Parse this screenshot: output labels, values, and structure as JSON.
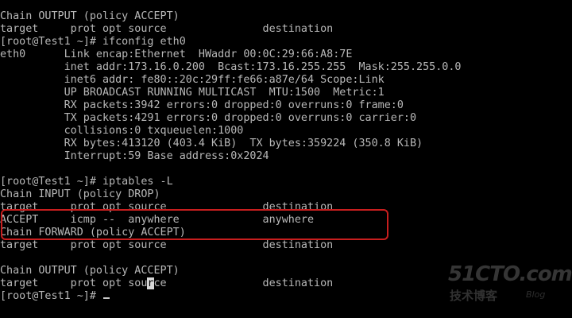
{
  "terminal": {
    "lines": [
      "Chain OUTPUT (policy ACCEPT)",
      "target     prot opt source               destination",
      "[root@Test1 ~]# ifconfig eth0",
      "eth0      Link encap:Ethernet  HWaddr 00:0C:29:66:A8:7E",
      "          inet addr:173.16.0.200  Bcast:173.16.255.255  Mask:255.255.0.0",
      "          inet6 addr: fe80::20c:29ff:fe66:a87e/64 Scope:Link",
      "          UP BROADCAST RUNNING MULTICAST  MTU:1500  Metric:1",
      "          RX packets:3942 errors:0 dropped:0 overruns:0 frame:0",
      "          TX packets:4291 errors:0 dropped:0 overruns:0 carrier:0",
      "          collisions:0 txqueuelen:1000",
      "          RX bytes:413120 (403.4 KiB)  TX bytes:359224 (350.8 KiB)",
      "          Interrupt:59 Base address:0x2024",
      "",
      "[root@Test1 ~]# iptables -L",
      "Chain INPUT (policy DROP)",
      "target     prot opt source               destination",
      "ACCEPT     icmp --  anywhere             anywhere",
      "Chain FORWARD (policy ACCEPT)",
      "target     prot opt source               destination",
      "",
      "Chain OUTPUT (policy ACCEPT)"
    ],
    "last_header": {
      "before_cursor": "target     prot opt sou",
      "cursor_char": "r",
      "after_cursor": "ce               destination"
    },
    "prompt": "[root@Test1 ~]# "
  },
  "watermark": {
    "main": "51CTO.com",
    "sub": "技术博客",
    "blog": "Blog"
  },
  "colors": {
    "background": "#000000",
    "text": "#b8b8b8",
    "highlight_border": "#c81e1e"
  }
}
